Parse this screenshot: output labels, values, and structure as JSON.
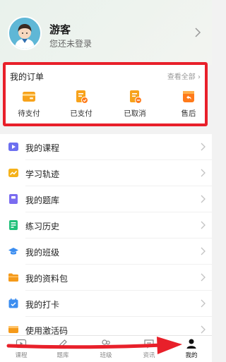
{
  "profile": {
    "username": "游客",
    "login_hint": "您还未登录"
  },
  "orders": {
    "title": "我的订单",
    "view_all": "查看全部",
    "items": [
      {
        "label": "待支付",
        "icon": "wallet-icon"
      },
      {
        "label": "已支付",
        "icon": "paid-icon"
      },
      {
        "label": "已取消",
        "icon": "cancelled-icon"
      },
      {
        "label": "售后",
        "icon": "after-sales-icon"
      }
    ]
  },
  "menu": {
    "items": [
      {
        "label": "我的课程",
        "icon": "video-icon",
        "color": "#6c6ff0"
      },
      {
        "label": "学习轨迹",
        "icon": "chart-icon",
        "color": "#f5b21a"
      },
      {
        "label": "我的题库",
        "icon": "question-bank-icon",
        "color": "#7a6cf0"
      },
      {
        "label": "练习历史",
        "icon": "history-icon",
        "color": "#21c07a"
      },
      {
        "label": "我的班级",
        "icon": "graduation-cap-icon",
        "color": "#3b8df0"
      },
      {
        "label": "我的资料包",
        "icon": "folder-icon",
        "color": "#f59a1a"
      },
      {
        "label": "我的打卡",
        "icon": "calendar-check-icon",
        "color": "#3b8df0"
      },
      {
        "label": "使用激活码",
        "icon": "ticket-icon",
        "color": "#f59a1a"
      }
    ]
  },
  "tabbar": {
    "items": [
      {
        "label": "课程",
        "icon": "play-icon",
        "active": false
      },
      {
        "label": "题库",
        "icon": "pen-icon",
        "active": false
      },
      {
        "label": "班级",
        "icon": "class-icon",
        "active": false
      },
      {
        "label": "资讯",
        "icon": "message-icon",
        "active": false
      },
      {
        "label": "我的",
        "icon": "user-icon",
        "active": true
      }
    ]
  },
  "colors": {
    "highlight": "#e8202a",
    "accent_orange": "#f5a623"
  }
}
